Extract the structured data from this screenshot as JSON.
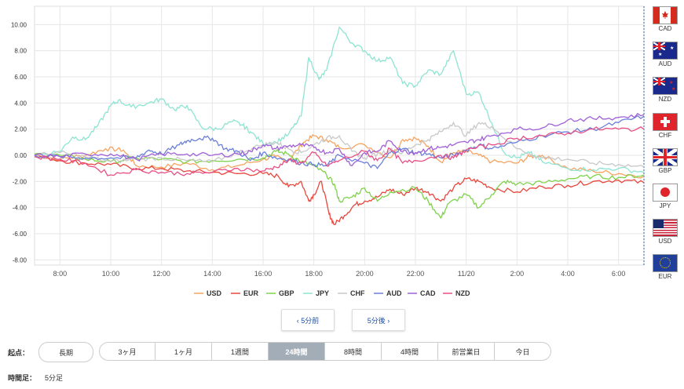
{
  "chart_data": {
    "type": "line",
    "y_ticks": [
      "10.00",
      "8.00",
      "6.00",
      "4.00",
      "2.00",
      "0.00",
      "-2.00",
      "-4.00",
      "-6.00",
      "-8.00"
    ],
    "ylim": [
      -8.4,
      11.4
    ],
    "x_ticks": [
      "8:00",
      "10:00",
      "12:00",
      "14:00",
      "16:00",
      "18:00",
      "20:00",
      "22:00",
      "11/20",
      "2:00",
      "4:00",
      "6:00"
    ],
    "x_tick_hours": [
      8,
      10,
      12,
      14,
      16,
      18,
      20,
      22,
      24,
      26,
      28,
      30
    ],
    "xlim": [
      7.0,
      31.0
    ],
    "grid": true,
    "legend_position": "bottom",
    "series": [
      {
        "name": "USD",
        "color": "#f4a460",
        "points": [
          [
            7.0,
            0.0
          ],
          [
            8,
            -0.3
          ],
          [
            9,
            0.0
          ],
          [
            9.8,
            0.5
          ],
          [
            10.5,
            0.4
          ],
          [
            11,
            -0.8
          ],
          [
            12,
            -0.9
          ],
          [
            13,
            -0.6
          ],
          [
            14,
            -1.1
          ],
          [
            15,
            -0.8
          ],
          [
            16,
            -0.3
          ],
          [
            16.5,
            -0.1
          ],
          [
            17,
            -0.4
          ],
          [
            17.6,
            1.0
          ],
          [
            18,
            1.5
          ],
          [
            18.5,
            1.2
          ],
          [
            19,
            0.6
          ],
          [
            20,
            0.8
          ],
          [
            21,
            -0.2
          ],
          [
            21.5,
            1.2
          ],
          [
            22,
            1.3
          ],
          [
            22.5,
            0.7
          ],
          [
            23,
            -0.5
          ],
          [
            23.5,
            0.2
          ],
          [
            24,
            0.3
          ],
          [
            24.5,
            0.0
          ],
          [
            25,
            -0.5
          ],
          [
            26,
            -0.6
          ],
          [
            26.5,
            -0.1
          ],
          [
            27,
            0.0
          ],
          [
            28,
            -1.0
          ],
          [
            29,
            -1.2
          ],
          [
            30,
            -1.4
          ],
          [
            31,
            -1.6
          ]
        ]
      },
      {
        "name": "EUR",
        "color": "#e8473d",
        "points": [
          [
            7.0,
            0.0
          ],
          [
            8,
            -0.4
          ],
          [
            9,
            -0.6
          ],
          [
            10,
            -0.7
          ],
          [
            11,
            -1.0
          ],
          [
            12,
            -1.0
          ],
          [
            13,
            -1.2
          ],
          [
            14,
            -1.3
          ],
          [
            15,
            -1.4
          ],
          [
            16,
            -1.4
          ],
          [
            16.6,
            -1.6
          ],
          [
            17,
            -2.4
          ],
          [
            17.5,
            -2.0
          ],
          [
            17.8,
            -3.5
          ],
          [
            18,
            -3.0
          ],
          [
            18.3,
            -2.0
          ],
          [
            18.6,
            -4.5
          ],
          [
            18.8,
            -5.3
          ],
          [
            19.2,
            -4.6
          ],
          [
            19.6,
            -3.8
          ],
          [
            20,
            -3.5
          ],
          [
            20.5,
            -3.2
          ],
          [
            21,
            -2.6
          ],
          [
            21.5,
            -3.0
          ],
          [
            22,
            -2.5
          ],
          [
            22.5,
            -2.8
          ],
          [
            23,
            -3.5
          ],
          [
            23.5,
            -2.5
          ],
          [
            24,
            -1.8
          ],
          [
            24.5,
            -2.0
          ],
          [
            25,
            -2.5
          ],
          [
            26,
            -2.8
          ],
          [
            27,
            -2.4
          ],
          [
            28,
            -2.3
          ],
          [
            29,
            -2.0
          ],
          [
            30,
            -1.9
          ],
          [
            31,
            -2.1
          ]
        ]
      },
      {
        "name": "GBP",
        "color": "#7fd24a",
        "points": [
          [
            7.0,
            0.1
          ],
          [
            8,
            0.0
          ],
          [
            9,
            -0.3
          ],
          [
            10,
            -0.5
          ],
          [
            11,
            -0.2
          ],
          [
            12,
            -0.3
          ],
          [
            13,
            -0.5
          ],
          [
            14,
            -0.4
          ],
          [
            15,
            -0.3
          ],
          [
            16,
            -0.2
          ],
          [
            16.5,
            0.3
          ],
          [
            17,
            0.1
          ],
          [
            17.5,
            -0.5
          ],
          [
            18,
            -0.8
          ],
          [
            18.5,
            -1.5
          ],
          [
            18.8,
            -2.2
          ],
          [
            19,
            -3.5
          ],
          [
            19.5,
            -3.2
          ],
          [
            20,
            -2.5
          ],
          [
            20.5,
            -3.5
          ],
          [
            21,
            -2.8
          ],
          [
            22,
            -2.5
          ],
          [
            22.5,
            -3.5
          ],
          [
            23,
            -4.8
          ],
          [
            23.3,
            -3.7
          ],
          [
            24,
            -3.0
          ],
          [
            24.5,
            -4.0
          ],
          [
            25,
            -3.0
          ],
          [
            25.5,
            -2.0
          ],
          [
            26,
            -2.2
          ],
          [
            27,
            -2.1
          ],
          [
            28,
            -1.8
          ],
          [
            29,
            -1.6
          ],
          [
            30,
            -1.7
          ],
          [
            31,
            -1.5
          ]
        ]
      },
      {
        "name": "JPY",
        "color": "#8ee4d2",
        "points": [
          [
            7.0,
            0.0
          ],
          [
            8,
            0.3
          ],
          [
            8.5,
            1.4
          ],
          [
            9,
            1.2
          ],
          [
            9.5,
            2.3
          ],
          [
            10,
            3.8
          ],
          [
            10.3,
            4.2
          ],
          [
            10.8,
            3.7
          ],
          [
            11.5,
            4.0
          ],
          [
            12,
            4.3
          ],
          [
            12.5,
            3.5
          ],
          [
            13,
            3.8
          ],
          [
            13.6,
            2.1
          ],
          [
            14.2,
            2.0
          ],
          [
            14.8,
            2.6
          ],
          [
            15.2,
            2.3
          ],
          [
            15.5,
            1.8
          ],
          [
            16,
            0.9
          ],
          [
            16.5,
            1.0
          ],
          [
            17,
            1.6
          ],
          [
            17.5,
            3.0
          ],
          [
            17.8,
            7.5
          ],
          [
            18.2,
            5.8
          ],
          [
            18.5,
            6.5
          ],
          [
            19,
            9.8
          ],
          [
            19.5,
            8.6
          ],
          [
            20,
            8.0
          ],
          [
            20.5,
            7.2
          ],
          [
            21,
            7.5
          ],
          [
            21.5,
            5.5
          ],
          [
            22,
            5.3
          ],
          [
            22.5,
            6.5
          ],
          [
            23,
            6.2
          ],
          [
            23.5,
            8.0
          ],
          [
            24,
            4.7
          ],
          [
            24.5,
            4.8
          ],
          [
            25,
            2.5
          ],
          [
            25.5,
            0.2
          ],
          [
            26,
            -0.2
          ],
          [
            26.5,
            0.2
          ],
          [
            27,
            -0.5
          ],
          [
            28,
            -1.0
          ],
          [
            29,
            -1.1
          ],
          [
            30,
            -1.0
          ],
          [
            31,
            -1.3
          ]
        ]
      },
      {
        "name": "CHF",
        "color": "#c8c8c8",
        "points": [
          [
            7.0,
            0.0
          ],
          [
            8,
            0.2
          ],
          [
            9,
            -0.1
          ],
          [
            10,
            -0.5
          ],
          [
            11,
            -0.3
          ],
          [
            12,
            -0.2
          ],
          [
            13,
            -0.4
          ],
          [
            14,
            -0.5
          ],
          [
            15,
            0.2
          ],
          [
            16,
            0.8
          ],
          [
            16.5,
            1.0
          ],
          [
            17,
            0.5
          ],
          [
            17.5,
            0.2
          ],
          [
            18,
            0.8
          ],
          [
            18.5,
            1.3
          ],
          [
            19,
            1.5
          ],
          [
            19.5,
            0.3
          ],
          [
            20,
            -0.2
          ],
          [
            20.5,
            0.1
          ],
          [
            21,
            0.4
          ],
          [
            21.5,
            0.2
          ],
          [
            22,
            0.8
          ],
          [
            22.5,
            1.2
          ],
          [
            23,
            1.8
          ],
          [
            23.5,
            2.5
          ],
          [
            24,
            1.5
          ],
          [
            24.5,
            2.5
          ],
          [
            25,
            2.2
          ],
          [
            26,
            0.5
          ],
          [
            27,
            -0.2
          ],
          [
            28,
            -0.3
          ],
          [
            29,
            -0.6
          ],
          [
            30,
            -0.7
          ],
          [
            31,
            -0.9
          ]
        ]
      },
      {
        "name": "AUD",
        "color": "#6a7fd9",
        "points": [
          [
            7.0,
            0.0
          ],
          [
            8,
            -0.1
          ],
          [
            9,
            -0.2
          ],
          [
            10,
            -0.2
          ],
          [
            11,
            -0.2
          ],
          [
            11.5,
            0.4
          ],
          [
            12,
            0.1
          ],
          [
            12.7,
            0.8
          ],
          [
            13,
            1.1
          ],
          [
            13.5,
            1.3
          ],
          [
            14,
            1.3
          ],
          [
            14.5,
            0.5
          ],
          [
            15,
            0.3
          ],
          [
            15.5,
            -0.4
          ],
          [
            16,
            0.2
          ],
          [
            16.5,
            -0.2
          ],
          [
            17,
            -0.3
          ],
          [
            17.5,
            -0.6
          ],
          [
            18,
            -0.7
          ],
          [
            18.5,
            -0.8
          ],
          [
            19,
            0.0
          ],
          [
            20,
            -0.6
          ],
          [
            20.5,
            -1.0
          ],
          [
            21,
            0.2
          ],
          [
            21.5,
            0.5
          ],
          [
            22,
            0.2
          ],
          [
            22.5,
            0.1
          ],
          [
            23,
            -0.2
          ],
          [
            23.5,
            0.0
          ],
          [
            24,
            0.4
          ],
          [
            24.5,
            0.8
          ],
          [
            25,
            0.5
          ],
          [
            26,
            1.0
          ],
          [
            27,
            1.5
          ],
          [
            28,
            1.8
          ],
          [
            29,
            2.0
          ],
          [
            30,
            2.5
          ],
          [
            31,
            3.0
          ]
        ]
      },
      {
        "name": "CAD",
        "color": "#a060d8",
        "points": [
          [
            7.0,
            0.0
          ],
          [
            8,
            -0.1
          ],
          [
            9,
            0.1
          ],
          [
            10,
            0.1
          ],
          [
            11,
            -0.3
          ],
          [
            12,
            0.1
          ],
          [
            13,
            0.1
          ],
          [
            14,
            0.0
          ],
          [
            15,
            0.1
          ],
          [
            15.5,
            0.3
          ],
          [
            16,
            0.8
          ],
          [
            16.5,
            0.5
          ],
          [
            17,
            0.7
          ],
          [
            17.5,
            0.8
          ],
          [
            18,
            0.6
          ],
          [
            18.5,
            0.2
          ],
          [
            19,
            0.5
          ],
          [
            19.5,
            -0.8
          ],
          [
            20,
            0.2
          ],
          [
            20.5,
            0.3
          ],
          [
            21,
            1.1
          ],
          [
            21.5,
            0.3
          ],
          [
            22,
            0.2
          ],
          [
            22.5,
            0.5
          ],
          [
            23,
            0.6
          ],
          [
            23.5,
            0.8
          ],
          [
            24,
            1.0
          ],
          [
            24.5,
            1.2
          ],
          [
            25,
            1.5
          ],
          [
            26,
            2.0
          ],
          [
            27,
            2.1
          ],
          [
            28,
            2.7
          ],
          [
            29,
            2.8
          ],
          [
            30,
            2.9
          ],
          [
            31,
            3.1
          ]
        ]
      },
      {
        "name": "NZD",
        "color": "#e84f86",
        "points": [
          [
            7.0,
            -0.1
          ],
          [
            8,
            -0.3
          ],
          [
            9,
            -0.6
          ],
          [
            10,
            -1.5
          ],
          [
            11,
            -1.1
          ],
          [
            12,
            -1.3
          ],
          [
            13,
            -1.4
          ],
          [
            14,
            -1.3
          ],
          [
            15,
            -1.0
          ],
          [
            16,
            -1.2
          ],
          [
            16.5,
            -0.9
          ],
          [
            17,
            -0.4
          ],
          [
            17.5,
            -0.6
          ],
          [
            18,
            0.2
          ],
          [
            18.5,
            -0.8
          ],
          [
            19,
            -0.4
          ],
          [
            20,
            0.3
          ],
          [
            20.5,
            -0.4
          ],
          [
            21,
            0.5
          ],
          [
            21.5,
            -0.6
          ],
          [
            22,
            -0.4
          ],
          [
            23,
            0.0
          ],
          [
            23.5,
            -0.2
          ],
          [
            24,
            0.4
          ],
          [
            25,
            0.8
          ],
          [
            26,
            1.3
          ],
          [
            27,
            1.5
          ],
          [
            28,
            1.7
          ],
          [
            29,
            2.0
          ],
          [
            30,
            2.0
          ],
          [
            31,
            2.0
          ]
        ]
      }
    ]
  },
  "flags": [
    {
      "code": "CAD"
    },
    {
      "code": "AUD"
    },
    {
      "code": "NZD"
    },
    {
      "code": "CHF"
    },
    {
      "code": "GBP"
    },
    {
      "code": "JPY"
    },
    {
      "code": "USD"
    },
    {
      "code": "EUR"
    }
  ],
  "nav": {
    "prev": "‹ 5分前",
    "next": "5分後 ›"
  },
  "controls": {
    "start_label": "起点：",
    "long_term": "長期",
    "ranges": [
      "3ヶ月",
      "1ヶ月",
      "1週間",
      "24時間",
      "8時間",
      "4時間",
      "前営業日",
      "今日"
    ],
    "active_range": "24時間",
    "timeframe_label": "時間足：",
    "timeframe_value": "5分足"
  }
}
